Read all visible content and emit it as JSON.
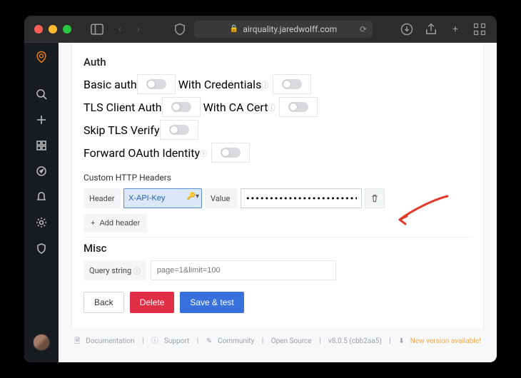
{
  "browser": {
    "url_host": "airquality.jaredwolff.com"
  },
  "sections": {
    "auth_title": "Auth",
    "custom_headers_title": "Custom HTTP Headers",
    "misc_title": "Misc"
  },
  "auth": {
    "basic_auth": "Basic auth",
    "with_credentials": "With Credentials",
    "tls_client_auth": "TLS Client Auth",
    "with_ca_cert": "With CA Cert",
    "skip_tls_verify": "Skip TLS Verify",
    "forward_oauth": "Forward OAuth Identity"
  },
  "headers": {
    "header_label": "Header",
    "value_label": "Value",
    "header_key": "X-API-Key",
    "header_value": "••••••••••••••••••••••••••••••••",
    "add_header": "Add header"
  },
  "misc": {
    "query_string_label": "Query string",
    "query_string_placeholder": "page=1&limit=100"
  },
  "buttons": {
    "back": "Back",
    "delete": "Delete",
    "save_test": "Save & test"
  },
  "footer": {
    "documentation": "Documentation",
    "support": "Support",
    "community": "Community",
    "open_source": "Open Source",
    "version": "v8.0.5 (cbb2aa5)",
    "new_version": "New version available!"
  }
}
